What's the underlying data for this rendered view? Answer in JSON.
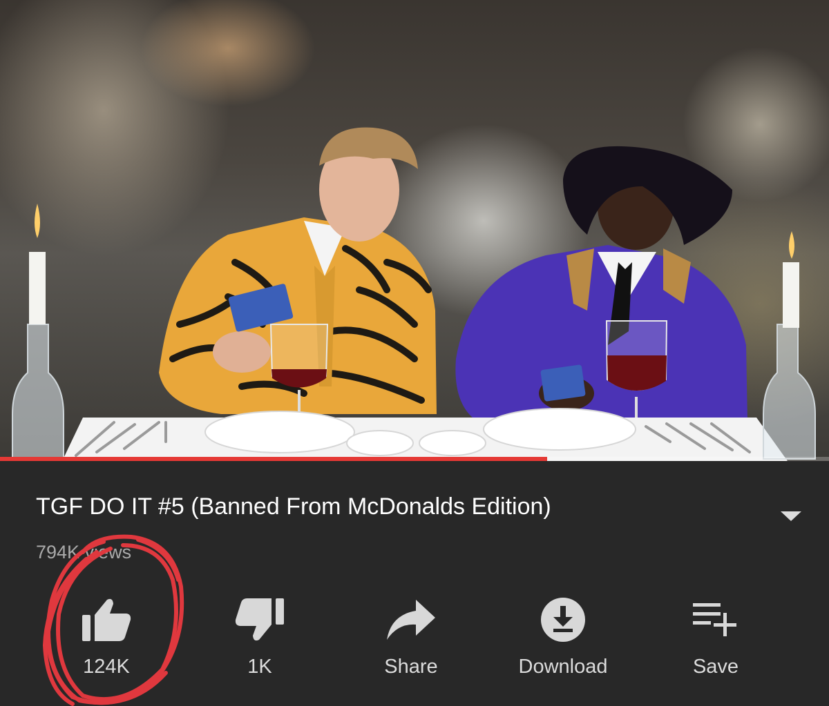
{
  "player": {
    "progress_fraction": 0.66
  },
  "video": {
    "title": "TGF DO IT #5 (Banned From McDonalds Edition)",
    "views": "794K views"
  },
  "actions": [
    {
      "id": "like",
      "label": "124K",
      "icon": "thumbs-up-icon"
    },
    {
      "id": "dislike",
      "label": "1K",
      "icon": "thumbs-down-icon"
    },
    {
      "id": "share",
      "label": "Share",
      "icon": "share-arrow-icon"
    },
    {
      "id": "download",
      "label": "Download",
      "icon": "download-icon"
    },
    {
      "id": "save",
      "label": "Save",
      "icon": "playlist-add-icon"
    }
  ],
  "colors": {
    "panel_bg": "#282828",
    "text_primary": "#ffffff",
    "text_secondary": "#aaaaaa",
    "icon": "#d8d8d8",
    "progress": "#e53935",
    "annotation": "#e0383e"
  }
}
